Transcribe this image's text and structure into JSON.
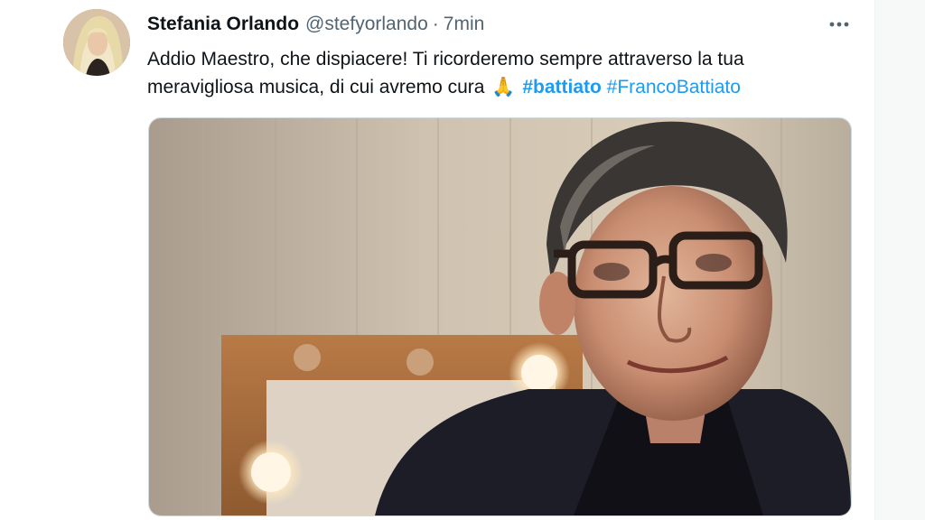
{
  "tweet": {
    "display_name": "Stefania Orlando",
    "handle": "@stefyorlando",
    "separator": "·",
    "time": "7min",
    "more_icon": "more-horizontal-icon",
    "text_line1": "Addio Maestro, che dispiacere! Ti ricorderemo sempre attraverso la tua",
    "text_line2": "meravigliosa musica,  di cui avremo cura",
    "emoji": "🙏",
    "hashtags": [
      "#battiato",
      "#FrancoBattiato"
    ],
    "link_color": "#1d9bf0"
  }
}
